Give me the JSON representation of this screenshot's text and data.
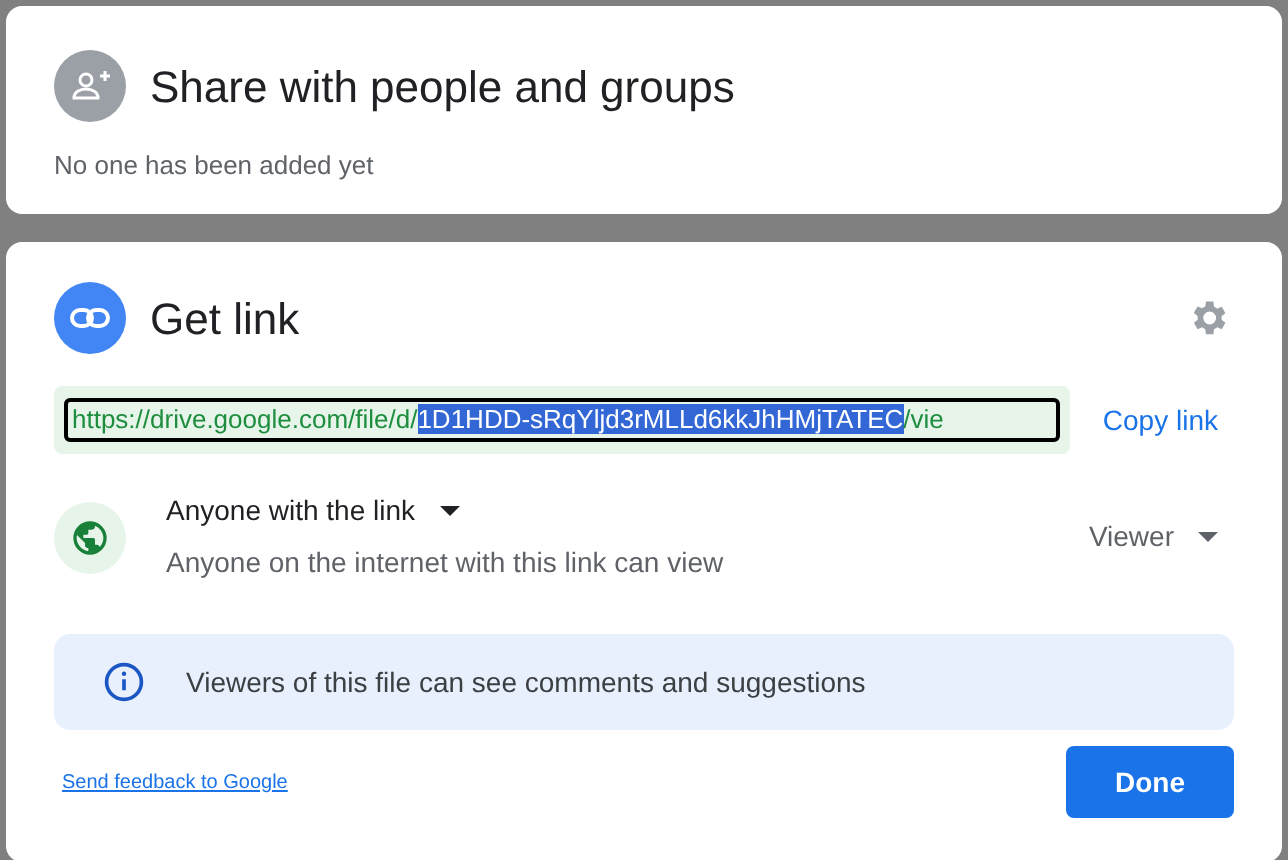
{
  "share_card": {
    "title": "Share with people and groups",
    "subtitle": "No one has been added yet"
  },
  "link_card": {
    "title": "Get link",
    "link": {
      "prefix": "https://drive.google.com/file/d/",
      "selection": "1D1HDD-sRqYljd3rMLLd6kkJhHMjTATEC",
      "suffix": "/vie"
    },
    "copy_button": "Copy link",
    "access": {
      "label": "Anyone with the link",
      "description": "Anyone on the internet with this link can view",
      "role": "Viewer"
    },
    "info": "Viewers of this file can see comments and suggestions",
    "feedback_link": "Send feedback to Google",
    "done_button": "Done"
  }
}
